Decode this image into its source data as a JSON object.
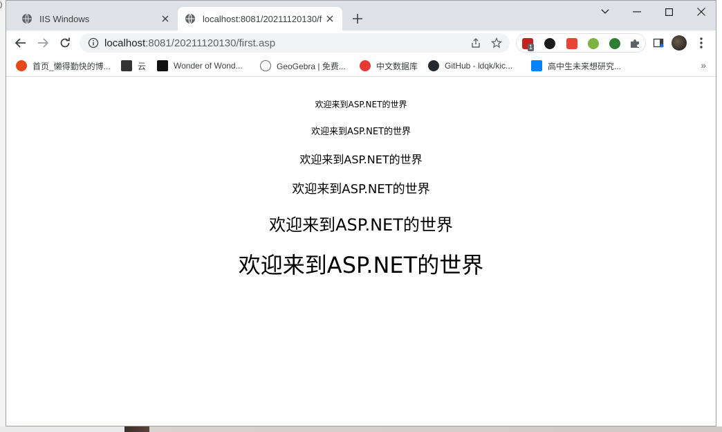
{
  "tabs": [
    {
      "title": "IIS Windows",
      "active": false
    },
    {
      "title": "localhost:8081/20211120130/f",
      "active": true
    }
  ],
  "window_controls": [
    "chevron-down",
    "minimize",
    "maximize",
    "close"
  ],
  "address": {
    "host": "localhost",
    "path": ":8081/20211120130/first.asp"
  },
  "extensions": [
    {
      "name": "ublock-icon",
      "color": "#c5221f",
      "badge": "1"
    },
    {
      "name": "tampermonkey-icon",
      "color": "#1b1b1b"
    },
    {
      "name": "red-ext-icon",
      "color": "#ea4335"
    },
    {
      "name": "green-plus-icon",
      "color": "#7cb342"
    },
    {
      "name": "globe-ext-icon",
      "color": "#2e7d32"
    },
    {
      "name": "puzzle-icon",
      "color": "#5f6368"
    }
  ],
  "bookmarks": [
    {
      "label": "首页_懒得勤快的博...",
      "icon": "strawberry-icon",
      "color": "#e64a19"
    },
    {
      "label": "云",
      "icon": "cloud-ghost-icon",
      "color": "#333333"
    },
    {
      "label": "Wonder of Wond...",
      "icon": "pixel-logo-icon",
      "color": "#111111"
    },
    {
      "label": "GeoGebra | 免费...",
      "icon": "geogebra-icon",
      "color": "#666666"
    },
    {
      "label": "中文数据库",
      "icon": "database-icon",
      "color": "#e53935"
    },
    {
      "label": "GitHub - ldqk/kic...",
      "icon": "github-icon",
      "color": "#24292f"
    },
    {
      "label": "高中生未来想研究...",
      "icon": "zhihu-icon",
      "color": "#0084ff"
    }
  ],
  "page": {
    "lines": [
      {
        "text": "欢迎来到ASP.NET的世界"
      },
      {
        "text": "欢迎来到ASP.NET的世界"
      },
      {
        "text": "欢迎来到ASP.NET的世界"
      },
      {
        "text": "欢迎来到ASP.NET的世界"
      },
      {
        "text": "欢迎来到ASP.NET的世界"
      },
      {
        "text": "欢迎来到ASP.NET的世界"
      }
    ]
  },
  "corner_glyph": ")"
}
